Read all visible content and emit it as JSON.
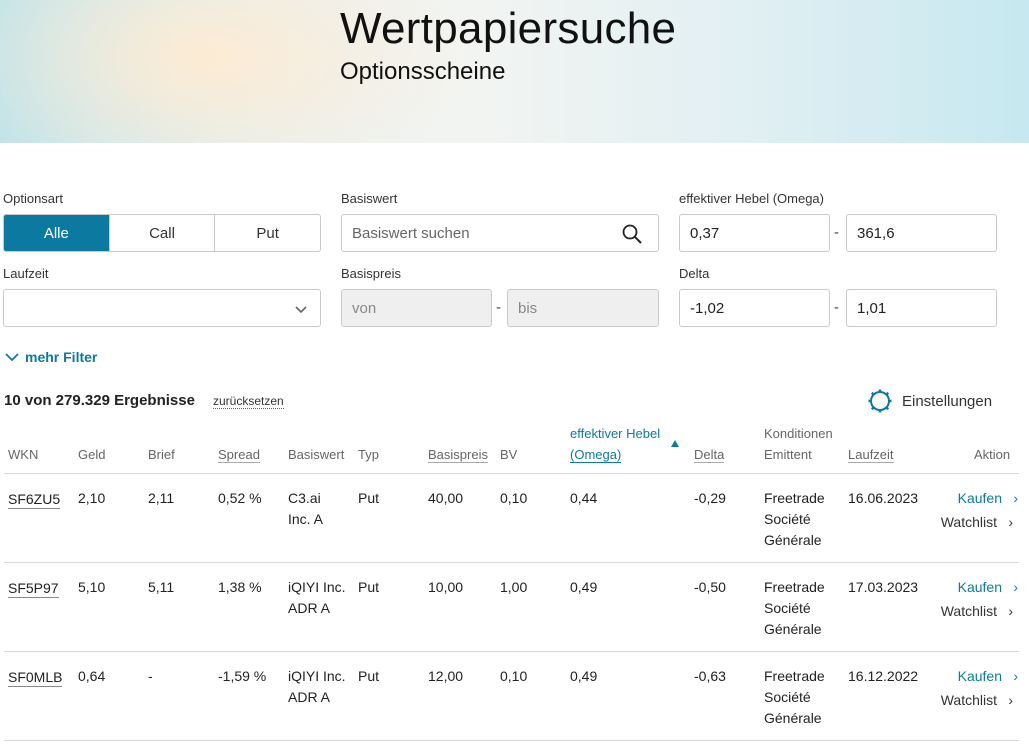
{
  "header": {
    "title": "Wertpapiersuche",
    "subtitle": "Optionsscheine"
  },
  "filters": {
    "optionsart": {
      "label": "Optionsart",
      "options": [
        "Alle",
        "Call",
        "Put"
      ],
      "selected": "Alle"
    },
    "basiswert": {
      "label": "Basiswert",
      "placeholder": "Basiswert suchen"
    },
    "hebel": {
      "label": "effektiver Hebel (Omega)",
      "from": "0,37",
      "to": "361,6"
    },
    "laufzeit": {
      "label": "Laufzeit",
      "value": ""
    },
    "basispreis": {
      "label": "Basispreis",
      "from_placeholder": "von",
      "to_placeholder": "bis"
    },
    "delta": {
      "label": "Delta",
      "from": "-1,02",
      "to": "1,01"
    },
    "separator": "-",
    "more_label": "mehr Filter"
  },
  "results": {
    "summary": "10 von 279.329 Ergebnisse",
    "reset_label": "zurücksetzen",
    "settings_label": "Einstellungen"
  },
  "table": {
    "headers": {
      "wkn": "WKN",
      "geld": "Geld",
      "brief": "Brief",
      "spread": "Spread",
      "basiswert": "Basiswert",
      "typ": "Typ",
      "basispreis": "Basispreis",
      "bv": "BV",
      "hebel_1": "effektiver Hebel",
      "hebel_2": "(Omega)",
      "delta": "Delta",
      "konditionen": "Konditionen",
      "emittent": "Emittent",
      "laufzeit": "Laufzeit",
      "aktion": "Aktion"
    },
    "rows": [
      {
        "wkn": "SF6ZU5",
        "geld": "2,10",
        "brief": "2,11",
        "spread": "0,52 %",
        "basiswert_1": "C3.ai",
        "basiswert_2": "Inc. A",
        "typ": "Put",
        "basispreis": "40,00",
        "bv": "0,10",
        "hebel": "0,44",
        "delta": "-0,29",
        "emittent_1": "Freetrade",
        "emittent_2": "Société",
        "emittent_3": "Générale",
        "laufzeit": "16.06.2023",
        "buy_label": "Kaufen",
        "watch_label": "Watchlist"
      },
      {
        "wkn": "SF5P97",
        "geld": "5,10",
        "brief": "5,11",
        "spread": "1,38 %",
        "basiswert_1": "iQIYI Inc.",
        "basiswert_2": "ADR A",
        "typ": "Put",
        "basispreis": "10,00",
        "bv": "1,00",
        "hebel": "0,49",
        "delta": "-0,50",
        "emittent_1": "Freetrade",
        "emittent_2": "Société",
        "emittent_3": "Générale",
        "laufzeit": "17.03.2023",
        "buy_label": "Kaufen",
        "watch_label": "Watchlist"
      },
      {
        "wkn": "SF0MLB",
        "geld": "0,64",
        "brief": "-",
        "spread": "-1,59 %",
        "basiswert_1": "iQIYI Inc.",
        "basiswert_2": "ADR A",
        "typ": "Put",
        "basispreis": "12,00",
        "bv": "0,10",
        "hebel": "0,49",
        "delta": "-0,63",
        "emittent_1": "Freetrade",
        "emittent_2": "Société",
        "emittent_3": "Générale",
        "laufzeit": "16.12.2022",
        "buy_label": "Kaufen",
        "watch_label": "Watchlist"
      }
    ]
  },
  "colors": {
    "accent": "#0c7aa0"
  }
}
